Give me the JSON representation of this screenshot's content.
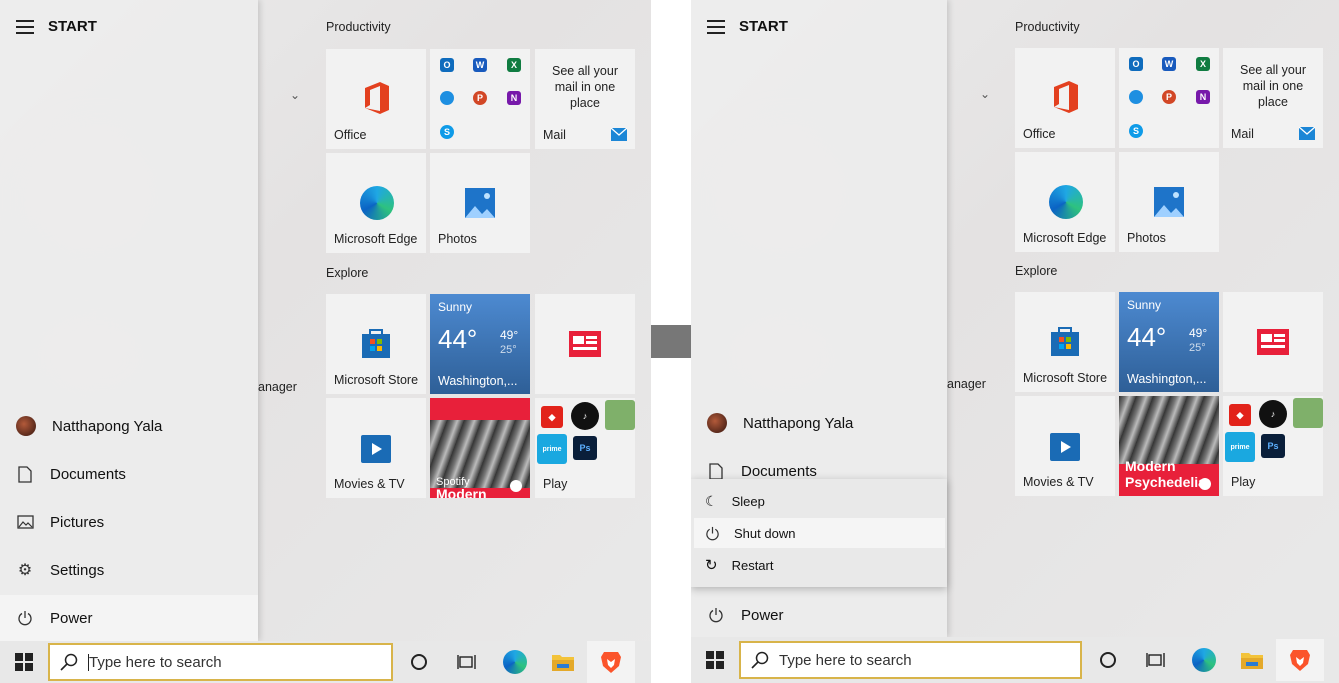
{
  "start": {
    "title": "START"
  },
  "sidebar": {
    "user": "Natthapong Yala",
    "documents": "Documents",
    "pictures": "Pictures",
    "settings": "Settings",
    "power": "Power"
  },
  "groups": {
    "productivity": "Productivity",
    "explore": "Explore"
  },
  "tiles": {
    "office": "Office",
    "mail_text": "See all your mail in one place",
    "mail": "Mail",
    "edge": "Microsoft Edge",
    "photos": "Photos",
    "store": "Microsoft Store",
    "movies": "Movies & TV",
    "play": "Play",
    "partial_label": "anager"
  },
  "weather": {
    "condition": "Sunny",
    "temp": "44°",
    "high": "49°",
    "low": "25°",
    "city": "Washington,..."
  },
  "spotify": {
    "title": "Modern Psychedelia",
    "left_title": "Modern",
    "app": "Spotify"
  },
  "power_menu": {
    "sleep": "Sleep",
    "shutdown": "Shut down",
    "restart": "Restart"
  },
  "taskbar": {
    "search_placeholder": "Type here to search"
  },
  "icons": [
    "hamburger-icon",
    "windows-icon",
    "search-icon",
    "cortana-icon",
    "task-view-icon",
    "edge-icon",
    "file-explorer-icon",
    "brave-icon",
    "document-icon",
    "pictures-icon",
    "settings-icon",
    "power-icon",
    "sleep-icon",
    "restart-icon",
    "chevron-down-icon"
  ],
  "colors": {
    "search_border": "#d8b44a",
    "weather_tile": "#3d74b5",
    "spotify_tile": "#e8203a"
  }
}
